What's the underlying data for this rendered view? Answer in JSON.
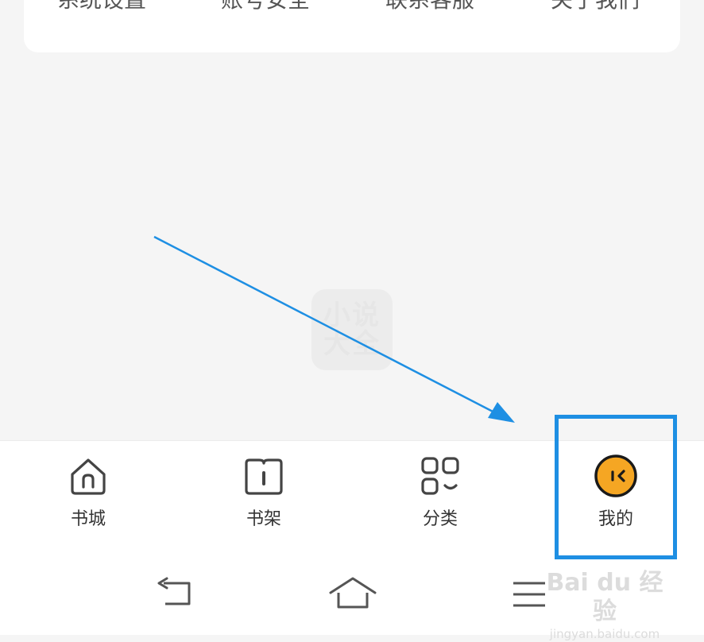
{
  "menu": {
    "items": [
      {
        "label": "系统设置"
      },
      {
        "label": "账号安全"
      },
      {
        "label": "联系客服"
      },
      {
        "label": "关于我们"
      }
    ]
  },
  "watermark": {
    "line1": "小说",
    "line2": "大全"
  },
  "tabs": [
    {
      "label": "书城",
      "icon": "home-icon"
    },
    {
      "label": "书架",
      "icon": "book-icon"
    },
    {
      "label": "分类",
      "icon": "category-icon"
    },
    {
      "label": "我的",
      "icon": "profile-avatar-icon",
      "active": true
    }
  ],
  "system_nav": {
    "back": "back-icon",
    "home": "home-nav-icon",
    "menu": "menu-icon"
  },
  "baidu": {
    "brand": "Bai du 经验",
    "url": "jingyan.baidu.com"
  },
  "colors": {
    "annotation": "#1e8fe3",
    "avatar": "#f5a623"
  }
}
